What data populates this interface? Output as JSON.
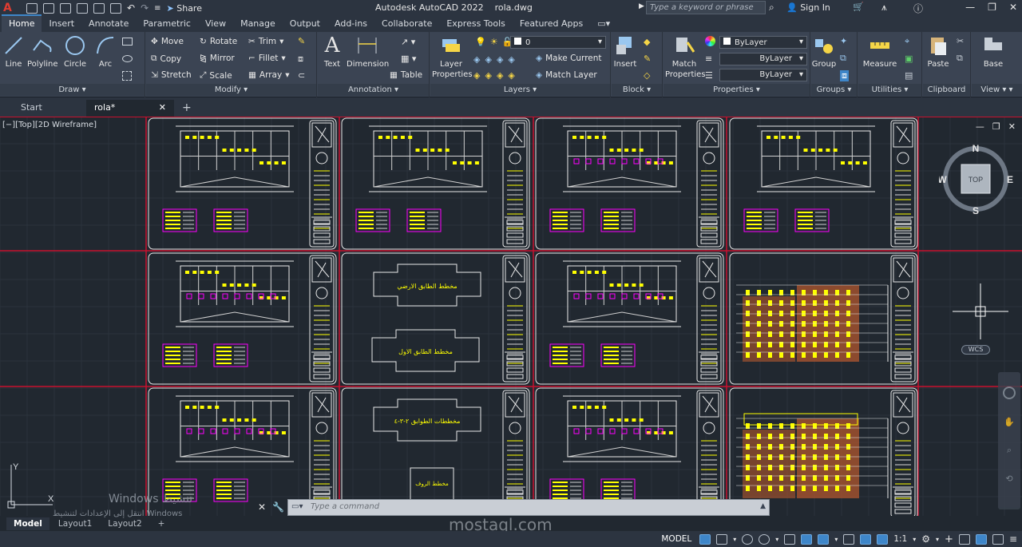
{
  "titlebar": {
    "app_title": "Autodesk AutoCAD 2022",
    "file_name": "rola.dwg",
    "share_label": "Share",
    "search_placeholder": "Type a keyword or phrase",
    "sign_in": "Sign In"
  },
  "ribbon_tabs": [
    "Home",
    "Insert",
    "Annotate",
    "Parametric",
    "View",
    "Manage",
    "Output",
    "Add-ins",
    "Collaborate",
    "Express Tools",
    "Featured Apps"
  ],
  "ribbon": {
    "draw": {
      "title": "Draw",
      "line": "Line",
      "polyline": "Polyline",
      "circle": "Circle",
      "arc": "Arc"
    },
    "modify": {
      "title": "Modify",
      "move": "Move",
      "rotate": "Rotate",
      "trim": "Trim",
      "copy": "Copy",
      "mirror": "Mirror",
      "fillet": "Fillet",
      "stretch": "Stretch",
      "scale": "Scale",
      "array": "Array"
    },
    "annotation": {
      "title": "Annotation",
      "text": "Text",
      "dimension": "Dimension",
      "table": "Table"
    },
    "layers": {
      "title": "Layers",
      "layer_properties_1": "Layer",
      "layer_properties_2": "Properties",
      "current_layer": "0",
      "make_current": "Make Current",
      "match_layer": "Match Layer"
    },
    "block": {
      "title": "Block",
      "insert": "Insert"
    },
    "properties": {
      "title": "Properties",
      "match_1": "Match",
      "match_2": "Properties",
      "color": "ByLayer",
      "linetype": "ByLayer",
      "lineweight": "ByLayer"
    },
    "groups": {
      "title": "Groups",
      "group": "Group"
    },
    "utilities": {
      "title": "Utilities",
      "measure": "Measure"
    },
    "clipboard": {
      "title": "Clipboard",
      "paste": "Paste"
    },
    "view": {
      "title": "View",
      "base": "Base"
    }
  },
  "doc_tabs": {
    "start": "Start",
    "active": "rola*"
  },
  "viewport": {
    "label": "[−][Top][2D Wireframe]",
    "navcube": {
      "n": "N",
      "s": "S",
      "e": "E",
      "w": "W",
      "top": "TOP",
      "wcs": "WCS"
    },
    "ucs_x": "X",
    "ucs_y": "Y",
    "plan_labels": [
      "مخطط الطابق الارضي",
      "مخطط الطابق الاول",
      "مخططات الطوابق ٢-٣-٤",
      "مخطط الروف"
    ]
  },
  "command_line": {
    "placeholder": "Type a command"
  },
  "layout_tabs": [
    "Model",
    "Layout1",
    "Layout2"
  ],
  "statusbar": {
    "model": "MODEL",
    "scale": "1:1"
  },
  "overlays": {
    "windows_activation": "Windows تنشيط",
    "windows_activation_2": "انتقل إلى الإعدادات لتنشيط Windows",
    "watermark": "mostaql.com"
  },
  "colors": {
    "accent": "#3e86c9",
    "background": "#212830",
    "ribbon": "#3b4453",
    "frame_red": "#c8102e",
    "cad_yellow": "#ffff00",
    "cad_magenta": "#ff00ff"
  }
}
